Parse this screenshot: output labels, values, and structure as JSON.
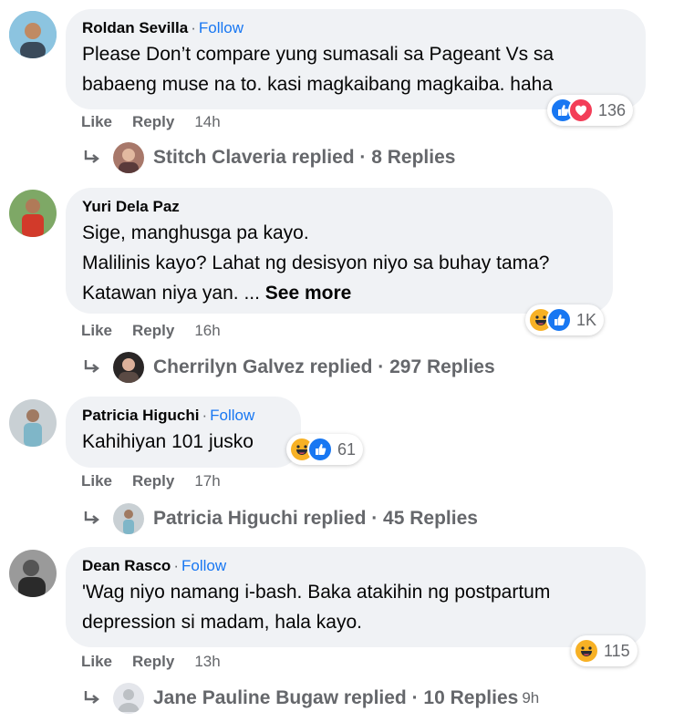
{
  "comments": [
    {
      "author": "Roldan Sevilla",
      "follow": "Follow",
      "lines": [
        "Please Don’t compare yung sumasali sa Pageant Vs sa",
        "babaeng muse na to. kasi magkaibang magkaiba. haha"
      ],
      "like": "Like",
      "reply": "Reply",
      "time": "14h",
      "reaction_count": "136",
      "reactions": [
        "like-icon",
        "love-icon"
      ],
      "replies_text": "Stitch Claveria replied · 8 Replies"
    },
    {
      "author": "Yuri Dela Paz",
      "lines": [
        "Sige, manghusga pa kayo.",
        "Malilinis kayo? Lahat ng desisyon niyo sa buhay tama?",
        "Katawan niya yan. ... "
      ],
      "see_more": "See more",
      "like": "Like",
      "reply": "Reply",
      "time": "16h",
      "reaction_count": "1K",
      "reactions": [
        "haha-icon",
        "like-icon"
      ],
      "replies_text": "Cherrilyn Galvez replied · 297 Replies"
    },
    {
      "author": "Patricia Higuchi",
      "follow": "Follow",
      "lines": [
        "Kahihiyan 101 jusko"
      ],
      "like": "Like",
      "reply": "Reply",
      "time": "17h",
      "reaction_count": "61",
      "reactions": [
        "haha-icon",
        "like-icon"
      ],
      "replies_text": "Patricia Higuchi replied · 45 Replies"
    },
    {
      "author": "Dean Rasco",
      "follow": "Follow",
      "lines": [
        "'Wag niyo namang i-bash. Baka atakihin ng postpartum",
        "depression si madam, hala kayo."
      ],
      "like": "Like",
      "reply": "Reply",
      "time": "13h",
      "reaction_count": "115",
      "reactions": [
        "haha-icon"
      ],
      "replies_text": "Jane Pauline Bugaw replied · 10 Replies",
      "replies_time": "9h"
    }
  ],
  "colors": {
    "bubble": "#f0f2f5",
    "follow": "#1877f2",
    "meta": "#65676b",
    "like": "#1877f2",
    "love": "#f33e58",
    "haha": "#f7b125"
  }
}
